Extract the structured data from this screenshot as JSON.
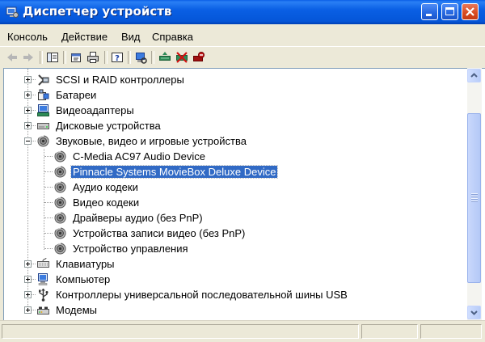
{
  "window": {
    "title": "Диспетчер устройств",
    "title_bar_color": "#0a5fe4",
    "icon": "computer-manage-icon"
  },
  "menu": [
    "Консоль",
    "Действие",
    "Вид",
    "Справка"
  ],
  "toolbar": {
    "icons": [
      "back-icon",
      "forward-icon",
      "console-tree-icon",
      "properties-icon",
      "print-icon",
      "help-icon",
      "scan-hardware-icon",
      "update-driver-icon",
      "disable-device-icon",
      "uninstall-device-icon"
    ]
  },
  "tree": {
    "selection_color": "#316ac5",
    "items": [
      {
        "label": "SCSI и RAID контроллеры",
        "level": 0,
        "state": "collapsed",
        "icon": "scsi-controller-icon"
      },
      {
        "label": "Батареи",
        "level": 0,
        "state": "collapsed",
        "icon": "battery-icon"
      },
      {
        "label": "Видеоадаптеры",
        "level": 0,
        "state": "collapsed",
        "icon": "display-adapter-icon"
      },
      {
        "label": "Дисковые устройства",
        "level": 0,
        "state": "collapsed",
        "icon": "disk-drive-icon"
      },
      {
        "label": "Звуковые, видео и игровые устройства",
        "level": 0,
        "state": "expanded",
        "icon": "sound-device-icon"
      },
      {
        "label": "C-Media AC97 Audio Device",
        "level": 1,
        "icon": "sound-device-icon"
      },
      {
        "label": "Pinnacle Systems MovieBox Deluxe Device",
        "level": 1,
        "icon": "sound-device-icon",
        "selected": true
      },
      {
        "label": "Аудио кодеки",
        "level": 1,
        "icon": "sound-device-icon"
      },
      {
        "label": "Видео кодеки",
        "level": 1,
        "icon": "sound-device-icon"
      },
      {
        "label": "Драйверы аудио (без PnP)",
        "level": 1,
        "icon": "sound-device-icon"
      },
      {
        "label": "Устройства записи видео (без PnP)",
        "level": 1,
        "icon": "sound-device-icon"
      },
      {
        "label": "Устройство управления",
        "level": 1,
        "icon": "sound-device-icon"
      },
      {
        "label": "Клавиатуры",
        "level": 0,
        "state": "collapsed",
        "icon": "keyboard-icon"
      },
      {
        "label": "Компьютер",
        "level": 0,
        "state": "collapsed",
        "icon": "computer-icon"
      },
      {
        "label": "Контроллеры универсальной последовательной шины USB",
        "level": 0,
        "state": "collapsed",
        "icon": "usb-icon"
      },
      {
        "label": "Модемы",
        "level": 0,
        "state": "collapsed",
        "icon": "modem-icon"
      }
    ]
  },
  "scrollbar": {
    "orientation": "vertical",
    "position_fraction": 0.2
  }
}
